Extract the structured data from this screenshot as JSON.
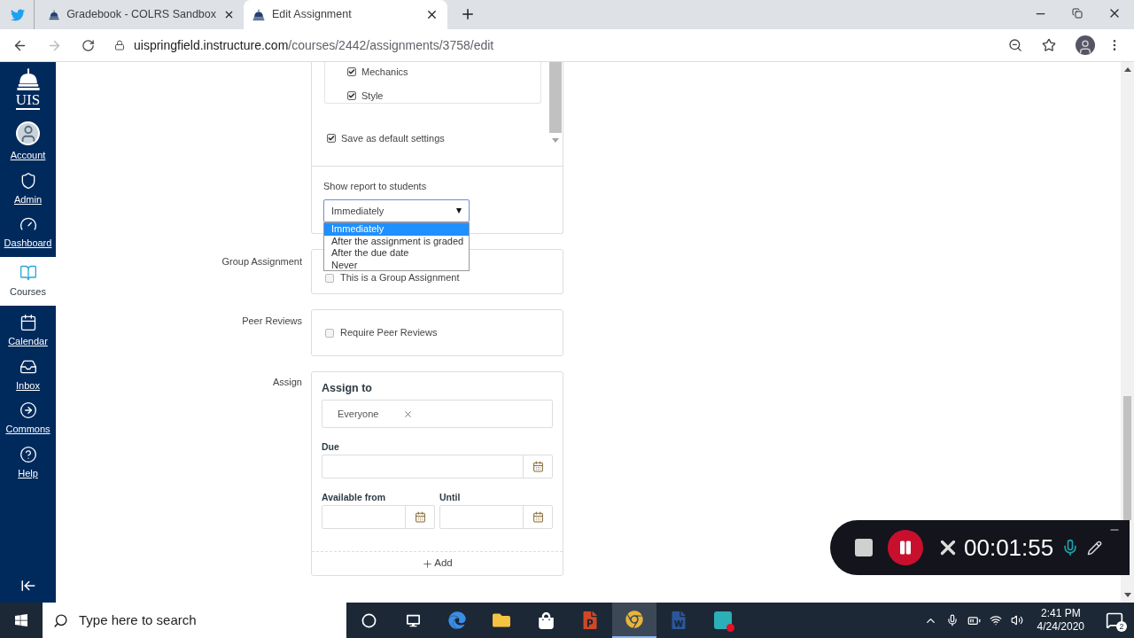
{
  "browser": {
    "tabs": [
      {
        "title": "Gradebook - COLRS Sandbox",
        "selected": false
      },
      {
        "title": "Edit Assignment",
        "selected": true
      }
    ],
    "address": {
      "host": "uispringfield.instructure.com",
      "path": "/courses/2442/assignments/3758/edit"
    }
  },
  "sidebar": {
    "logo": "UIS",
    "items": [
      {
        "label": "Account",
        "kind": "account",
        "selected": false
      },
      {
        "label": "Admin",
        "kind": "admin",
        "selected": false
      },
      {
        "label": "Dashboard",
        "kind": "dashboard",
        "selected": false
      },
      {
        "label": "Courses",
        "kind": "courses",
        "selected": true
      },
      {
        "label": "Calendar",
        "kind": "calendar",
        "selected": false
      },
      {
        "label": "Inbox",
        "kind": "inbox",
        "selected": false
      },
      {
        "label": "Commons",
        "kind": "commons",
        "selected": false
      },
      {
        "label": "Help",
        "kind": "help",
        "selected": false
      }
    ]
  },
  "report_settings": {
    "options": [
      {
        "label": "Mechanics",
        "checked": true
      },
      {
        "label": "Style",
        "checked": true
      }
    ],
    "save_default": {
      "label": "Save as default settings",
      "checked": true
    },
    "show_report": {
      "label": "Show report to students",
      "value": "Immediately",
      "dropdown_options": [
        {
          "label": "Immediately",
          "selected": true
        },
        {
          "label": "After the assignment is graded",
          "selected": false
        },
        {
          "label": "After the due date",
          "selected": false
        },
        {
          "label": "Never",
          "selected": false
        }
      ]
    }
  },
  "group_assignment": {
    "label": "Group Assignment",
    "checkbox": {
      "label": "This is a Group Assignment",
      "checked": false
    }
  },
  "peer_reviews": {
    "label": "Peer Reviews",
    "checkbox": {
      "label": "Require Peer Reviews",
      "checked": false
    }
  },
  "assign": {
    "label": "Assign",
    "heading": "Assign to",
    "assignees": [
      "Everyone"
    ],
    "due_label": "Due",
    "available_from_label": "Available from",
    "until_label": "Until",
    "add_label": "Add"
  },
  "recorder": {
    "time": "00:01:55"
  },
  "taskbar": {
    "search_placeholder": "Type here to search",
    "time": "2:41 PM",
    "date": "4/24/2020",
    "notifications": "2"
  }
}
